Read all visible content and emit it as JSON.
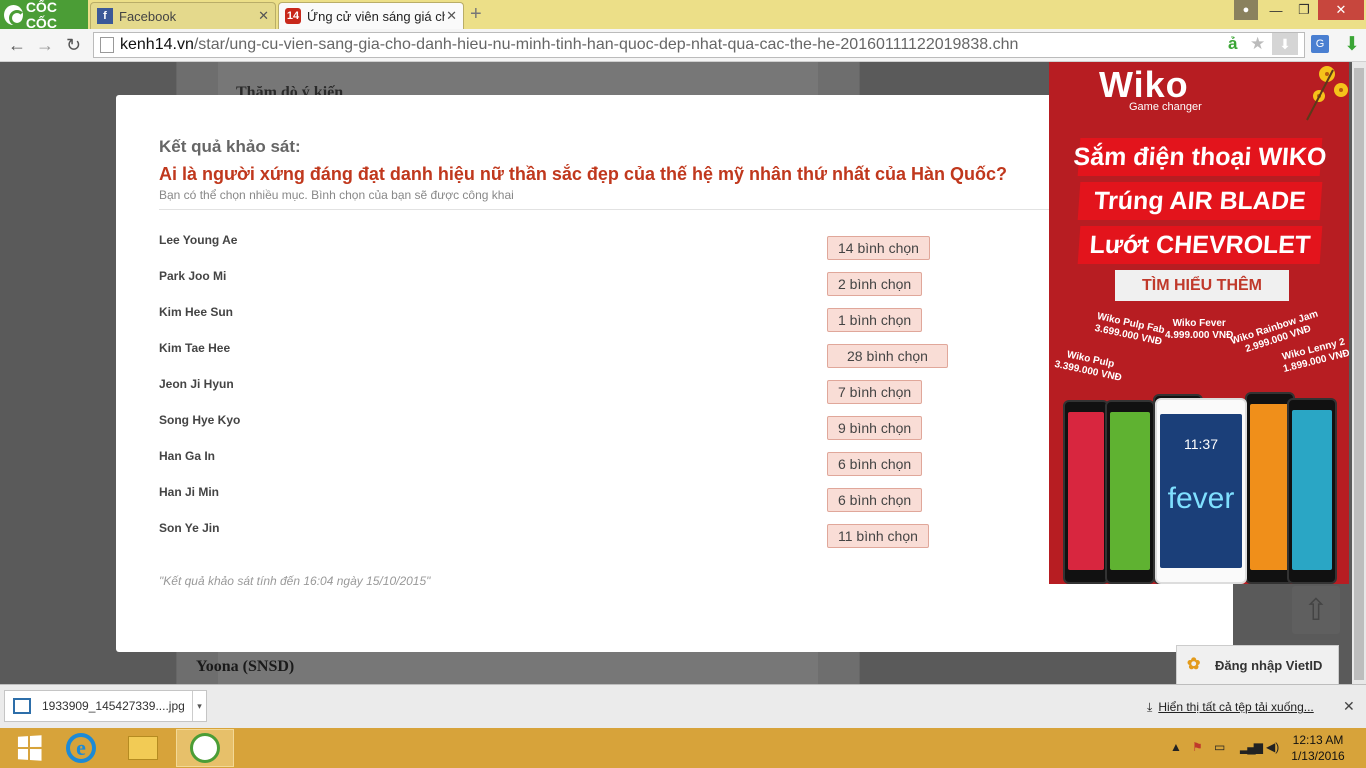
{
  "browser": {
    "brand": "CỐC CỐC",
    "tabs": [
      {
        "title": "Facebook",
        "favicon": "facebook-icon"
      },
      {
        "title": "Ứng cử viên sáng giá cho",
        "favicon": "kenh14-icon",
        "favicon_text": "14"
      }
    ],
    "tab_close_glyph": "✕",
    "new_tab_glyph": "+",
    "url": {
      "host": "kenh14.vn",
      "path": "/star/ung-cu-vien-sang-gia-cho-danh-hieu-nu-minh-tinh-han-quoc-dep-nhat-qua-cac-the-he-20160111122019838.chn"
    },
    "window_controls": {
      "minimize": "—",
      "maximize": "❐",
      "close": "✕"
    },
    "nav": {
      "back": "←",
      "forward": "→",
      "reload": "↻"
    }
  },
  "page": {
    "poll_heading_peek": "Thăm dò ý kiến",
    "below_modal_text": "Yoona (SNSD)"
  },
  "poll": {
    "heading": "Kết quả khảo sát:",
    "question": "Ai là người xứng đáng đạt danh hiệu nữ thần sắc đẹp của thế hệ mỹ nhân thứ nhất của Hàn Quốc?",
    "note": "Bạn có thể chọn nhiều mục. Bình chọn của bạn sẽ được công khai",
    "vote_suffix": "bình chọn",
    "results": [
      {
        "name": "Lee Young Ae",
        "votes": 14,
        "label": "14 bình chọn"
      },
      {
        "name": "Park Joo Mi",
        "votes": 2,
        "label": "2 bình chọn"
      },
      {
        "name": "Kim Hee Sun",
        "votes": 1,
        "label": "1 bình chọn"
      },
      {
        "name": "Kim Tae Hee",
        "votes": 28,
        "label": "28 bình chọn"
      },
      {
        "name": "Jeon Ji Hyun",
        "votes": 7,
        "label": "7 bình chọn"
      },
      {
        "name": "Song Hye Kyo",
        "votes": 9,
        "label": "9 bình chọn"
      },
      {
        "name": "Han Ga In",
        "votes": 6,
        "label": "6 bình chọn"
      },
      {
        "name": "Han Ji Min",
        "votes": 6,
        "label": "6 bình chọn"
      },
      {
        "name": "Son Ye Jin",
        "votes": 11,
        "label": "11 bình chọn"
      }
    ],
    "footer": "\"Kết quả khảo sát tính đến 16:04 ngày 15/10/2015\""
  },
  "ad": {
    "brand": "Wiko",
    "tagline": "Game changer",
    "lines": [
      "Sắm điện thoại WIKO",
      "Trúng AIR BLADE",
      "Lướt CHEVROLET"
    ],
    "cta": "TÌM HIỂU THÊM",
    "phones": [
      {
        "name": "Wiko Pulp",
        "price": "3.399.000 VNĐ"
      },
      {
        "name": "Wiko Pulp Fab",
        "price": "3.699.000 VNĐ"
      },
      {
        "name": "Wiko Fever",
        "price": "4.999.000 VNĐ"
      },
      {
        "name": "Wiko Rainbow Jam",
        "price": "2.999.000 VNĐ"
      },
      {
        "name": "Wiko Lenny 2",
        "price": "1.899.000 VNĐ"
      }
    ],
    "screen_time": "11:37",
    "fever_text": "fever",
    "colors": {
      "bg": "#b71d22",
      "band": "#e3141c"
    }
  },
  "widgets": {
    "vietid_label": "Đăng nhập VietID",
    "go_top_glyph": "⇧"
  },
  "downloads": {
    "file": "1933909_145427339....jpg",
    "show_all": "Hiển thị tất cả tệp tải xuống...",
    "close_glyph": "✕"
  },
  "taskbar": {
    "time": "12:13 AM",
    "date": "1/13/2016"
  }
}
